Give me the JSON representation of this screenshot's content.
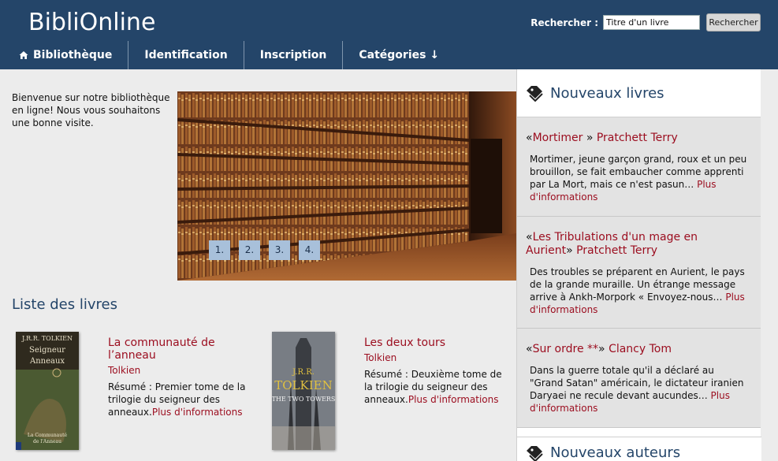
{
  "header": {
    "brand": "BibliOnline",
    "search": {
      "label": "Rechercher :",
      "placeholder": "Titre d'un livre",
      "button": "Rechercher"
    },
    "nav": [
      {
        "label": "Bibliothèque",
        "icon": "home-icon"
      },
      {
        "label": "Identification"
      },
      {
        "label": "Inscription"
      },
      {
        "label": "Catégories ↓"
      }
    ]
  },
  "main": {
    "welcome": "Bienvenue sur notre bibliothèque en ligne! Nous vous souhaitons une bonne visite.",
    "slider": {
      "dots": [
        "1.",
        "2.",
        "3.",
        "4."
      ]
    },
    "books_title": "Liste des livres",
    "books": [
      {
        "title": "La communauté de l’anneau",
        "author": "Tolkien",
        "summary": "Résumé : Premier tome de la trilogie du seigneur des anneaux.",
        "more": "Plus d'informations",
        "cover_text": [
          "J.R.R. TOLKIEN",
          "LE SEIGNEUR DES ANNEAUX",
          "1. La Communauté de l'Anneau"
        ]
      },
      {
        "title": "Les deux tours",
        "author": "Tolkien",
        "summary": "Résumé : Deuxième tome de la trilogie du seigneur des anneaux.",
        "more": "Plus d'informations",
        "cover_text": [
          "J.R.R. TOLKIEN",
          "THE TWO TOWERS"
        ]
      }
    ]
  },
  "sidebar": {
    "new_books_title": "Nouveaux livres",
    "items": [
      {
        "open": "«",
        "title": "Mortimer",
        "close": " »",
        "author": "Pratchett Terry",
        "desc": "Mortimer, jeune garçon grand, roux et un peu brouillon, se fait embaucher comme apprenti par La Mort, mais ce n'est pasun… ",
        "more": "Plus d'informations"
      },
      {
        "open": "«",
        "title": "Les Tribulations d'un mage en Aurient",
        "close": "»",
        "author": "Pratchett Terry",
        "desc": "Des troubles se préparent en Aurient, le pays de la grande muraille. Un étrange message arrive à Ankh-Morpork « Envoyez-nous… ",
        "more": "Plus d'informations"
      },
      {
        "open": "«",
        "title": "Sur ordre **",
        "close": "»",
        "author": "Clancy Tom",
        "desc": "Dans la guerre totale qu'il a déclaré au \"Grand Satan\" américain, le dictateur iranien Daryaei ne recule devant aucundes… ",
        "more": "Plus d'informations"
      }
    ],
    "new_authors_title": "Nouveaux auteurs"
  },
  "colors": {
    "header": "#244569",
    "link": "#9b0c1e",
    "sidebar_item_bg": "#e3e3e3",
    "slider_dot": "#a8c0da"
  }
}
